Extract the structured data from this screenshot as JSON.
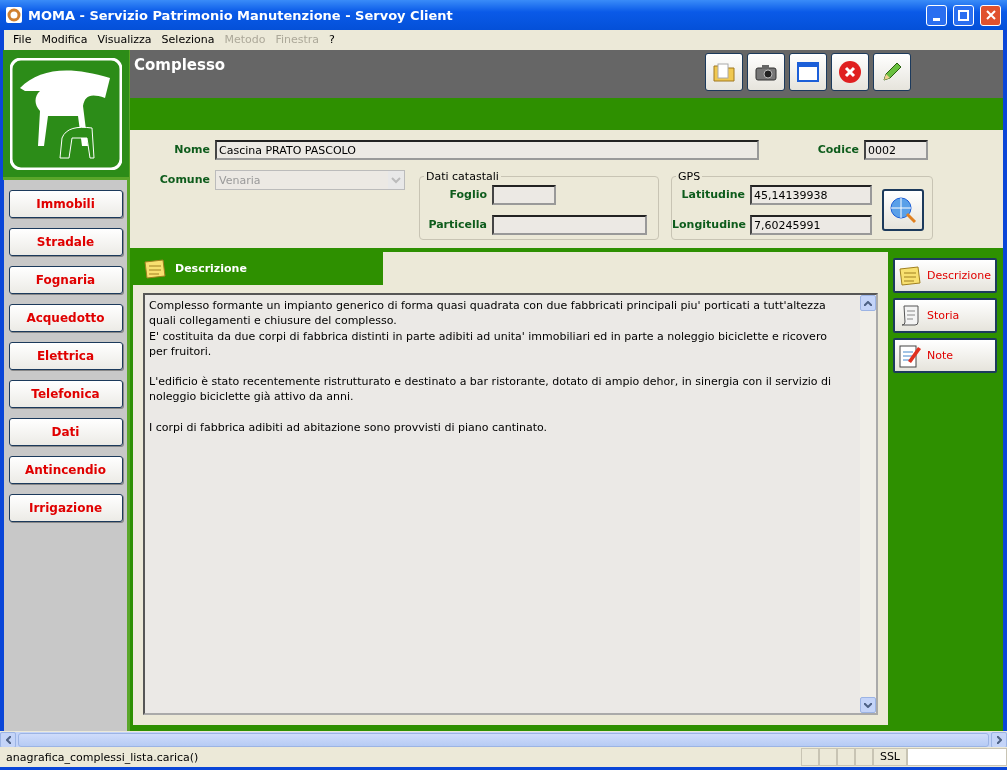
{
  "window": {
    "title": "MOMA - Servizio Patrimonio Manutenzione - Servoy Client"
  },
  "menu": [
    {
      "label": "File",
      "disabled": false
    },
    {
      "label": "Modifica",
      "disabled": false
    },
    {
      "label": "Visualizza",
      "disabled": false
    },
    {
      "label": "Seleziona",
      "disabled": false
    },
    {
      "label": "Metodo",
      "disabled": true
    },
    {
      "label": "Finestra",
      "disabled": true
    },
    {
      "label": "?",
      "disabled": false
    }
  ],
  "sidebar": {
    "items": [
      "Immobili",
      "Stradale",
      "Fognaria",
      "Acquedotto",
      "Elettrica",
      "Telefonica",
      "Dati",
      "Antincendio",
      "Irrigazione"
    ]
  },
  "header": {
    "title": "Complesso",
    "tools": [
      {
        "kind": "folder"
      },
      {
        "kind": "camera"
      },
      {
        "kind": "window"
      },
      {
        "kind": "close"
      },
      {
        "kind": "pencil"
      }
    ]
  },
  "form": {
    "nome": {
      "label": "Nome",
      "value": "Cascina PRATO PASCOLO"
    },
    "codice": {
      "label": "Codice",
      "value": "0002"
    },
    "comune": {
      "label": "Comune",
      "value": "Venaria",
      "disabled": true
    },
    "catasto": {
      "legend": "Dati catastali",
      "foglio": {
        "label": "Foglio"
      },
      "particella": {
        "label": "Particella"
      }
    },
    "gps": {
      "legend": "GPS",
      "latitudine": {
        "label": "Latitudine",
        "value": "45,14139938"
      },
      "longitudine": {
        "label": "Longitudine",
        "value": "7,60245991"
      }
    }
  },
  "tab": {
    "title": "Descrizione",
    "paragraphs": [
      [
        "Complesso formante un impianto generico di forma quasi quadrata con due fabbricati principali piu' porticati a tutt'altezza",
        "quali collegamenti e chiusure del complesso.",
        "E' costituita da due corpi di fabbrica distinti in parte adibiti ad unita' immobiliari ed in parte a noleggio biciclette e ricovero",
        "per fruitori."
      ],
      [
        "L'edificio è stato recentemente ristrutturato e destinato a bar ristorante, dotato di ampio dehor, in sinergia con il servizio di",
        "noleggio biciclette già attivo da anni."
      ],
      [
        "I corpi di fabbrica adibiti ad abitazione sono provvisti di piano cantinato."
      ]
    ]
  },
  "side_tabs": [
    {
      "label": "Descrizione",
      "kind": "note"
    },
    {
      "label": "Storia",
      "kind": "scroll"
    },
    {
      "label": "Note",
      "kind": "notepad"
    }
  ],
  "status_bar": {
    "text": "anagrafica_complessi_lista.carica()",
    "ssl": "SSL"
  }
}
